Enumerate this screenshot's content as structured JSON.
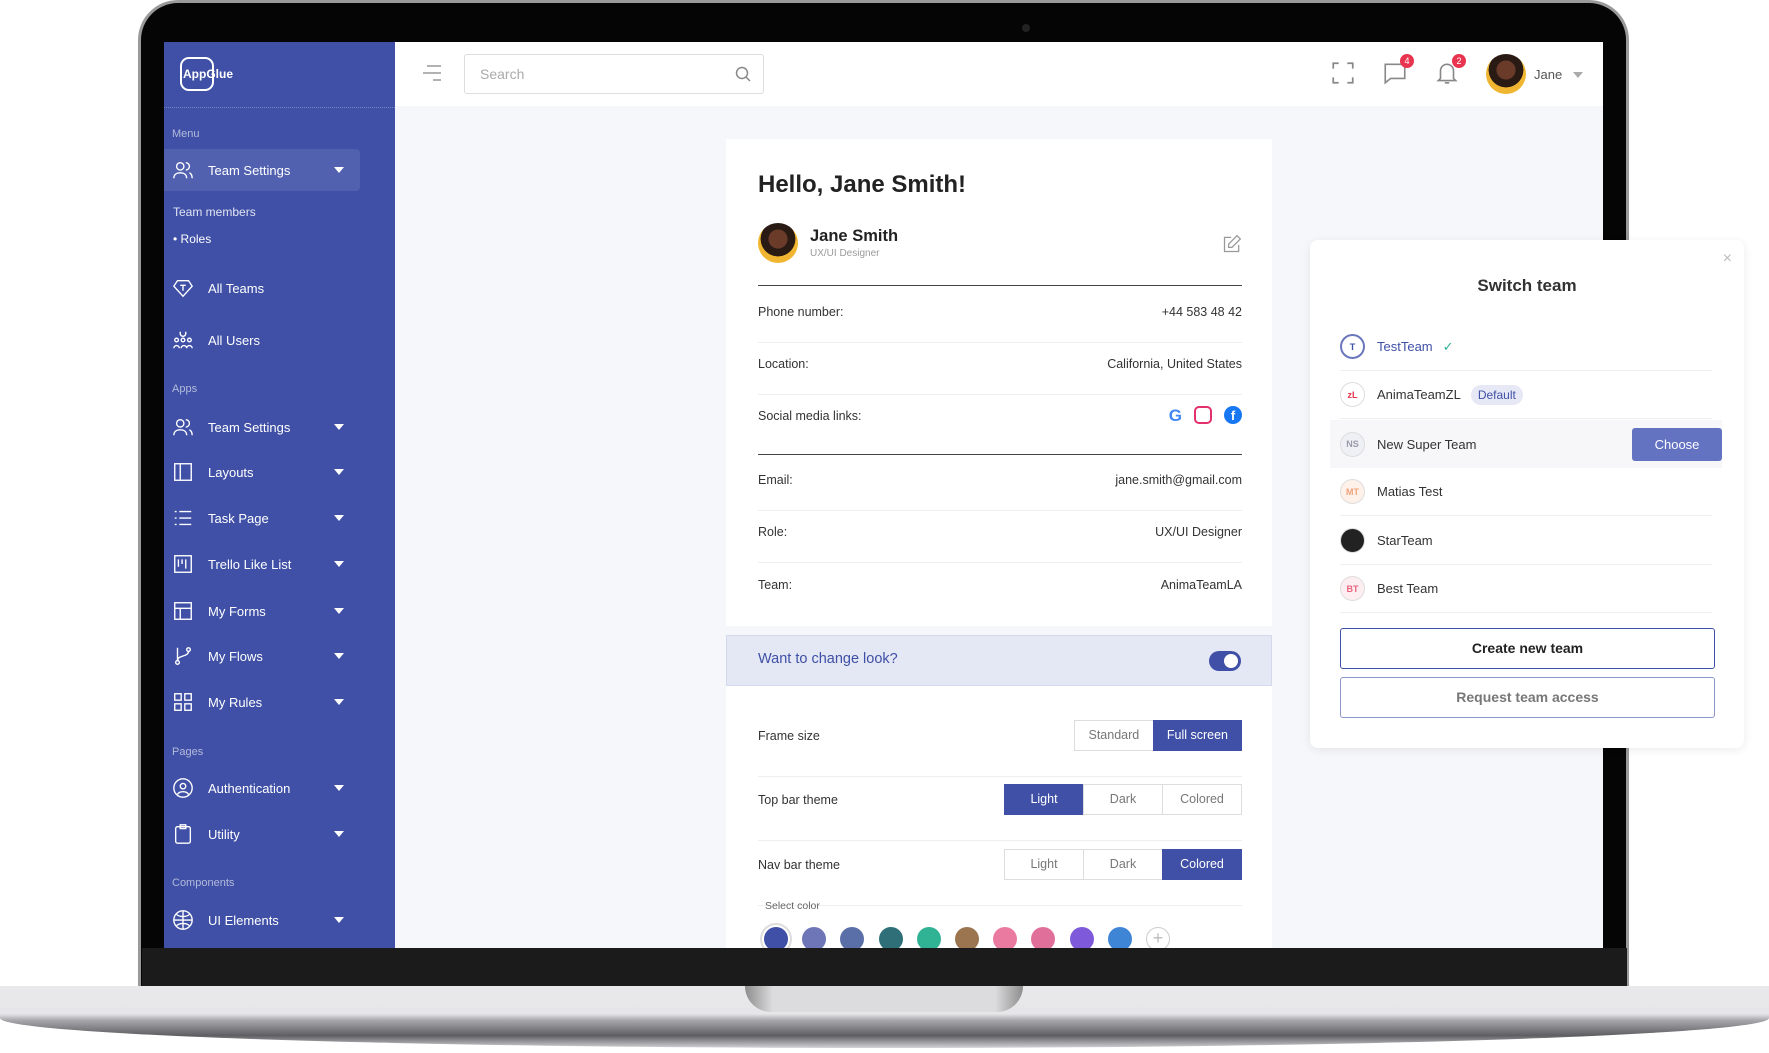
{
  "brand": {
    "logo": "AppGlue",
    "accent": "#3f50a6"
  },
  "sidebar": {
    "sections": {
      "menu": "Menu",
      "apps": "Apps",
      "pages": "Pages",
      "components": "Components"
    },
    "menu_item": {
      "label": "Team Settings",
      "icon": "users-icon"
    },
    "submenu": [
      "Team members",
      "Roles"
    ],
    "items": [
      {
        "label": "All Teams",
        "icon": "diamond-icon"
      },
      {
        "label": "All Users",
        "icon": "group-icon"
      }
    ],
    "apps": [
      {
        "label": "Team Settings",
        "icon": "users-icon"
      },
      {
        "label": "Layouts",
        "icon": "layout-icon"
      },
      {
        "label": "Task Page",
        "icon": "list-icon"
      },
      {
        "label": "Trello Like List",
        "icon": "kanban-icon"
      },
      {
        "label": "My Forms",
        "icon": "form-icon"
      },
      {
        "label": "My Flows",
        "icon": "flow-icon"
      },
      {
        "label": "My Rules",
        "icon": "grid-icon"
      }
    ],
    "pages": [
      {
        "label": "Authentication",
        "icon": "user-circle-icon"
      },
      {
        "label": "Utility",
        "icon": "clipboard-icon"
      }
    ],
    "components": [
      {
        "label": "UI Elements",
        "icon": "globe-icon"
      }
    ]
  },
  "topbar": {
    "search_placeholder": "Search",
    "messages_count": "4",
    "notifications_count": "2",
    "user": "Jane"
  },
  "profile": {
    "greeting": "Hello, Jane Smith!",
    "name": "Jane Smith",
    "title": "UX/UI Designer",
    "fields": [
      {
        "label": "Phone number:",
        "value": "+44 583 48 42"
      },
      {
        "label": "Location:",
        "value": "California, United States"
      },
      {
        "label": "Social media links:",
        "value": ""
      },
      {
        "label": "Email:",
        "value": "jane.smith@gmail.com"
      },
      {
        "label": "Role:",
        "value": "UX/UI Designer"
      },
      {
        "label": "Team:",
        "value": "AnimaTeamLA"
      }
    ],
    "social": [
      "google-icon",
      "instagram-icon",
      "facebook-icon"
    ]
  },
  "look": {
    "label": "Want to change look?",
    "enabled": true,
    "frame_size": {
      "label": "Frame size",
      "options": [
        "Standard",
        "Full screen"
      ],
      "selected": "Full screen"
    },
    "top_bar_theme": {
      "label": "Top bar theme",
      "options": [
        "Light",
        "Dark",
        "Colored"
      ],
      "selected": "Light"
    },
    "nav_bar_theme": {
      "label": "Nav bar theme",
      "options": [
        "Light",
        "Dark",
        "Colored"
      ],
      "selected": "Colored"
    },
    "select_color_label": "Select color",
    "colors": [
      "#3f50a6",
      "#6f76b8",
      "#5a6ea8",
      "#2f6f78",
      "#2fb394",
      "#9a7550",
      "#ea7aa0",
      "#e06f9a",
      "#7e5adb",
      "#3f85d6"
    ],
    "selected_color": "#3f50a6"
  },
  "switch_team": {
    "title": "Switch team",
    "teams": [
      {
        "initials": "T",
        "name": "TestTeam",
        "current": true
      },
      {
        "initials": "zL",
        "name": "AnimaTeamZL",
        "badge": "Default"
      },
      {
        "initials": "NS",
        "name": "New Super Team",
        "action": "Choose"
      },
      {
        "initials": "MT",
        "name": "Matias Test"
      },
      {
        "initials": "",
        "name": "StarTeam"
      },
      {
        "initials": "BT",
        "name": "Best Team"
      }
    ],
    "create": "Create new team",
    "request": "Request team access"
  }
}
